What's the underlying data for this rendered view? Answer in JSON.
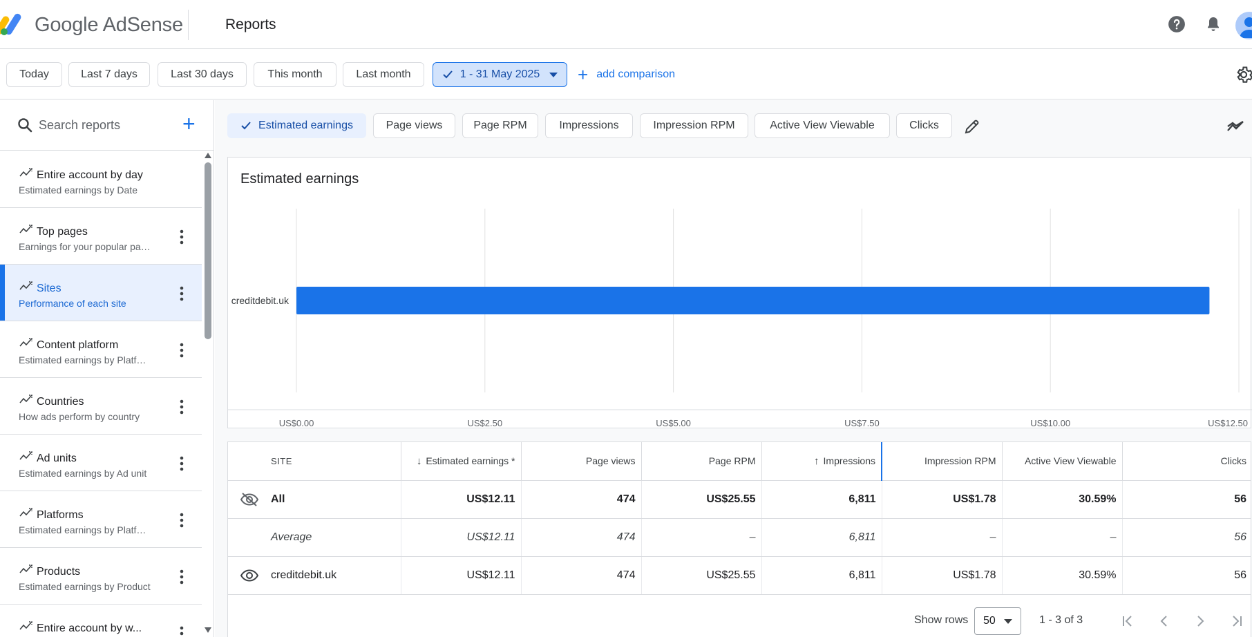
{
  "header": {
    "brand_google": "Google",
    "brand_product": "AdSense",
    "page_title": "Reports"
  },
  "datebar": {
    "chips": [
      "Today",
      "Last 7 days",
      "Last 30 days",
      "This month",
      "Last month"
    ],
    "active_range": "1 - 31 May 2025",
    "add_comparison": "add comparison"
  },
  "sidebar": {
    "search_placeholder": "Search reports",
    "items": [
      {
        "title": "Entire account by day",
        "subtitle": "Estimated earnings by Date"
      },
      {
        "title": "Top pages",
        "subtitle": "Earnings for your popular pages"
      },
      {
        "title": "Sites",
        "subtitle": "Performance of each site"
      },
      {
        "title": "Content platform",
        "subtitle": "Estimated earnings by Platform"
      },
      {
        "title": "Countries",
        "subtitle": "How ads perform by country"
      },
      {
        "title": "Ad units",
        "subtitle": "Estimated earnings by Ad unit"
      },
      {
        "title": "Platforms",
        "subtitle": "Estimated earnings by Platform"
      },
      {
        "title": "Products",
        "subtitle": "Estimated earnings by Product"
      },
      {
        "title": "Entire account by w...",
        "subtitle": ""
      }
    ]
  },
  "metrics": {
    "chips": [
      "Estimated earnings",
      "Page views",
      "Page RPM",
      "Impressions",
      "Impression RPM",
      "Active View Viewable",
      "Clicks"
    ]
  },
  "chart": {
    "title": "Estimated earnings"
  },
  "chart_data": {
    "type": "bar",
    "orientation": "horizontal",
    "title": "Estimated earnings",
    "categories": [
      "creditdebit.uk"
    ],
    "values": [
      12.11
    ],
    "xlim": [
      0,
      12.5
    ],
    "x_ticks": [
      "US$0.00",
      "US$2.50",
      "US$5.00",
      "US$7.50",
      "US$10.00",
      "US$12.50"
    ],
    "x_tick_values": [
      0,
      2.5,
      5,
      7.5,
      10,
      12.5
    ],
    "bar_color": "#1a73e8",
    "grid": true
  },
  "table": {
    "columns": [
      "SITE",
      "Estimated earnings *",
      "Page views",
      "Page RPM",
      "Impressions",
      "Impression RPM",
      "Active View Viewable",
      "Clicks"
    ],
    "rows": [
      {
        "site": "All",
        "cells": [
          "US$12.11",
          "474",
          "US$25.55",
          "6,811",
          "US$1.78",
          "30.59%",
          "56"
        ]
      },
      {
        "site": "Average",
        "cells": [
          "US$12.11",
          "474",
          "–",
          "6,811",
          "–",
          "–",
          "56"
        ]
      },
      {
        "site": "creditdebit.uk",
        "cells": [
          "US$12.11",
          "474",
          "US$25.55",
          "6,811",
          "US$1.78",
          "30.59%",
          "56"
        ]
      }
    ]
  },
  "pager": {
    "show_rows_label": "Show rows",
    "rows_value": "50",
    "range": "1 - 3 of 3"
  },
  "colors": {
    "accent": "#1a73e8",
    "selected_bg": "#e8f0fe",
    "chip_active_bg": "#d2e3fc"
  }
}
